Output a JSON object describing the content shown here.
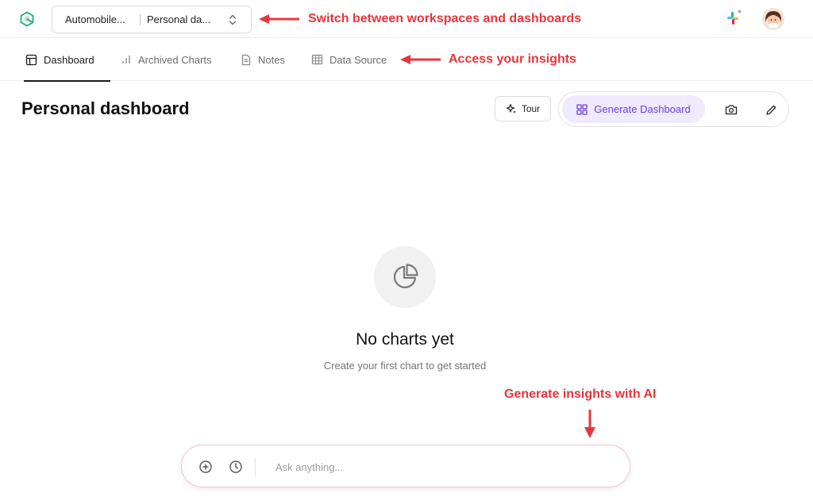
{
  "topbar": {
    "workspace": "Automobile...",
    "dashboard": "Personal da...",
    "annotation": "Switch between workspaces and dashboards"
  },
  "tabs": [
    {
      "label": "Dashboard",
      "icon": "layout-icon",
      "active": true
    },
    {
      "label": "Archived Charts",
      "icon": "bar-chart-icon",
      "active": false
    },
    {
      "label": "Notes",
      "icon": "document-icon",
      "active": false
    },
    {
      "label": "Data Source",
      "icon": "table-icon",
      "active": false
    }
  ],
  "tabs_annotation": "Access your insights",
  "header": {
    "title": "Personal dashboard",
    "tour_label": "Tour",
    "generate_label": "Generate Dashboard"
  },
  "empty_state": {
    "title": "No charts yet",
    "subtitle": "Create your first chart to get started"
  },
  "ask": {
    "placeholder": "Ask anything...",
    "annotation": "Generate insights with AI"
  },
  "colors": {
    "annotation": "#e8353b",
    "accent": "#6a3fd8",
    "accent_bg": "#efeafd"
  }
}
